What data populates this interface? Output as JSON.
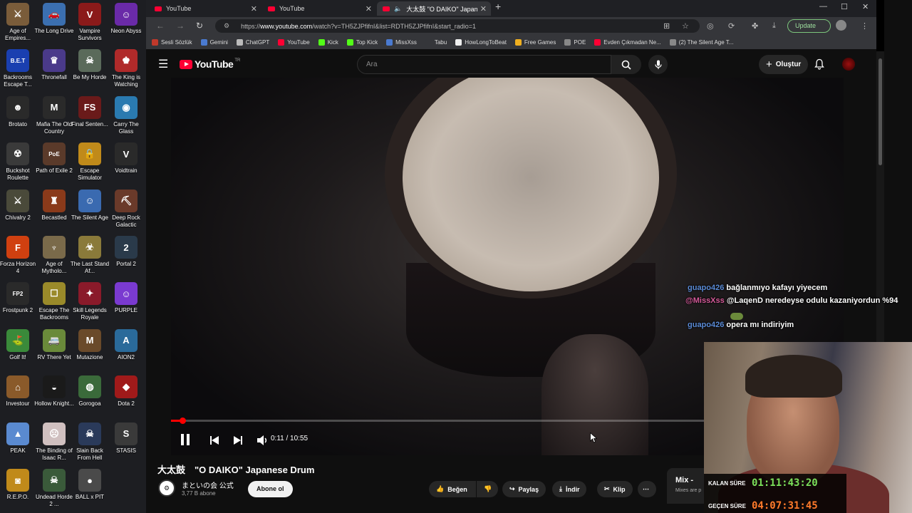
{
  "desktop": {
    "icons": [
      {
        "label": "Age of Empires...",
        "color": "#7a5c3a",
        "glyph": "⚔"
      },
      {
        "label": "The Long Drive",
        "color": "#3b6fb0",
        "glyph": "🚗"
      },
      {
        "label": "Vampire Survivors",
        "color": "#8b1a1a",
        "glyph": "V"
      },
      {
        "label": "Neon Abyss",
        "color": "#6a2aa8",
        "glyph": "☺"
      },
      {
        "label": "Backrooms Escape T...",
        "color": "#1a3fb0",
        "glyph": "B.E.T"
      },
      {
        "label": "Thronefall",
        "color": "#4a3a8a",
        "glyph": "♛"
      },
      {
        "label": "Be My Horde",
        "color": "#5a6a5a",
        "glyph": "☠"
      },
      {
        "label": "The King is Watching",
        "color": "#b02a2a",
        "glyph": "♚"
      },
      {
        "label": "Brotato",
        "color": "#2a2a2a",
        "glyph": "☻"
      },
      {
        "label": "Mafia The Old Country",
        "color": "#2a2a2a",
        "glyph": "M"
      },
      {
        "label": "Final Senten...",
        "color": "#6a1a1a",
        "glyph": "FS"
      },
      {
        "label": "Carry The Glass",
        "color": "#2a7ab0",
        "glyph": "◉"
      },
      {
        "label": "Buckshot Roulette",
        "color": "#3a3a3a",
        "glyph": "☢"
      },
      {
        "label": "Path of Exile 2",
        "color": "#5a3a2a",
        "glyph": "PoE"
      },
      {
        "label": "Escape Simulator",
        "color": "#c08a1a",
        "glyph": "🔒"
      },
      {
        "label": "Voidtrain",
        "color": "#2a2a2a",
        "glyph": "V"
      },
      {
        "label": "Chivalry 2",
        "color": "#4a4a3a",
        "glyph": "⚔"
      },
      {
        "label": "Becastled",
        "color": "#8a3a1a",
        "glyph": "♜"
      },
      {
        "label": "The Silent Age",
        "color": "#3a6ab0",
        "glyph": "☺"
      },
      {
        "label": "Deep Rock Galactic",
        "color": "#6a3a2a",
        "glyph": "⛏"
      },
      {
        "label": "Forza Horizon 4",
        "color": "#d04010",
        "glyph": "F"
      },
      {
        "label": "Age of Mytholo...",
        "color": "#7a6a4a",
        "glyph": "♆"
      },
      {
        "label": "The Last Stand Af...",
        "color": "#8a7a3a",
        "glyph": "☣"
      },
      {
        "label": "Portal 2",
        "color": "#2a3a4a",
        "glyph": "2"
      },
      {
        "label": "Frostpunk 2",
        "color": "#2a2a2a",
        "glyph": "FP2"
      },
      {
        "label": "Escape The Backrooms",
        "color": "#9a8a2a",
        "glyph": "☐"
      },
      {
        "label": "Skill Legends Royale",
        "color": "#8a1a2a",
        "glyph": "✦"
      },
      {
        "label": "PURPLE",
        "color": "#7a3ad0",
        "glyph": "☺"
      },
      {
        "label": "Golf It!",
        "color": "#3a8a3a",
        "glyph": "⛳"
      },
      {
        "label": "RV There Yet",
        "color": "#6a8a3a",
        "glyph": "🚐"
      },
      {
        "label": "Mutazione",
        "color": "#6a4a2a",
        "glyph": "M"
      },
      {
        "label": "AION2",
        "color": "#2a6a9a",
        "glyph": "A"
      },
      {
        "label": "Investour",
        "color": "#8a5a2a",
        "glyph": "⌂"
      },
      {
        "label": "Hollow Knight...",
        "color": "#1a1a1a",
        "glyph": "◒"
      },
      {
        "label": "Gorogoa",
        "color": "#3a6a3a",
        "glyph": "◍"
      },
      {
        "label": "Dota 2",
        "color": "#a01a1a",
        "glyph": "◆"
      },
      {
        "label": "PEAK",
        "color": "#5a8ad0",
        "glyph": "▲"
      },
      {
        "label": "The Binding of Isaac R...",
        "color": "#d0c0c0",
        "glyph": "☹"
      },
      {
        "label": "Slain Back From Hell",
        "color": "#2a3a5a",
        "glyph": "☠"
      },
      {
        "label": "STASIS",
        "color": "#3a3a3a",
        "glyph": "S"
      },
      {
        "label": "R.E.P.O.",
        "color": "#c08a1a",
        "glyph": "◙"
      },
      {
        "label": "Undead Horde 2 ...",
        "color": "#3a5a3a",
        "glyph": "☠"
      },
      {
        "label": "BALL x PIT",
        "color": "#4a4a4a",
        "glyph": "●"
      }
    ]
  },
  "browser": {
    "tabs": [
      {
        "label": "YouTube"
      },
      {
        "label": "YouTube"
      },
      {
        "label": "大太鼓 \"O DAIKO\" Japanese"
      }
    ],
    "url_prefix": "https://",
    "url_host": "www.youtube.com",
    "url_path": "/watch?v=TH5ZJPfifnI&list=RDTH5ZJPfifnI&start_radio=1",
    "update_label": "Update",
    "bookmarks": [
      {
        "label": "Sesli Sözlük",
        "color": "#c0392b"
      },
      {
        "label": "Gemini",
        "color": "#4a7ad0"
      },
      {
        "label": "ChatGPT",
        "color": "#bbbbbb"
      },
      {
        "label": "YouTube",
        "color": "#ff0033"
      },
      {
        "label": "Kick",
        "color": "#53fc18"
      },
      {
        "label": "Top Kick",
        "color": "#53fc18"
      },
      {
        "label": "MissXss",
        "color": "#4a7ad0"
      },
      {
        "label": "Tabu",
        "color": "#35363a"
      },
      {
        "label": "HowLongToBeat",
        "color": "#eeeeee"
      },
      {
        "label": "Free Games",
        "color": "#f0b020"
      },
      {
        "label": "POE",
        "color": "#888888"
      },
      {
        "label": "Evden Çıkmadan Ne...",
        "color": "#ff0033"
      },
      {
        "label": "(2) The Silent Age T...",
        "color": "#888888"
      }
    ]
  },
  "youtube": {
    "logo_text": "YouTube",
    "region": "TR",
    "search_placeholder": "Ara",
    "create_label": "Oluştur",
    "player": {
      "time": "0:11 / 10:55",
      "progress_fraction": 0.017
    },
    "video_title": "大太鼓　\"O DAIKO\" Japanese Drum",
    "channel_name": "まといの会 公式",
    "subscribers": "3,77 B abone",
    "subscribe_label": "Abone ol",
    "actions": {
      "like": "Beğen",
      "share": "Paylaş",
      "download": "İndir",
      "clip": "Klip"
    },
    "mix_title": "Mix - ",
    "mix_sub": "Mixes are p"
  },
  "stream": {
    "chat": [
      {
        "user": "guapo426",
        "message": "bağlanmıyo kafayı yiyecem",
        "user_color": "#5b8bd6"
      },
      {
        "user": "@MissXss",
        "message": "@LaqenD neredeyse odulu kazaniyordun %94",
        "user_color": "#d65b9b"
      },
      {
        "user": "guapo426",
        "message": "opera mı indiriyim",
        "user_color": "#5b8bd6"
      }
    ],
    "timers": {
      "remaining_label": "KALAN SÜRE",
      "remaining_value": "01:11:43:20",
      "remaining_color": "#7be05a",
      "elapsed_label": "GEÇEN SÜRE",
      "elapsed_value": "04:07:31:45",
      "elapsed_color": "#ff7a2a"
    }
  }
}
